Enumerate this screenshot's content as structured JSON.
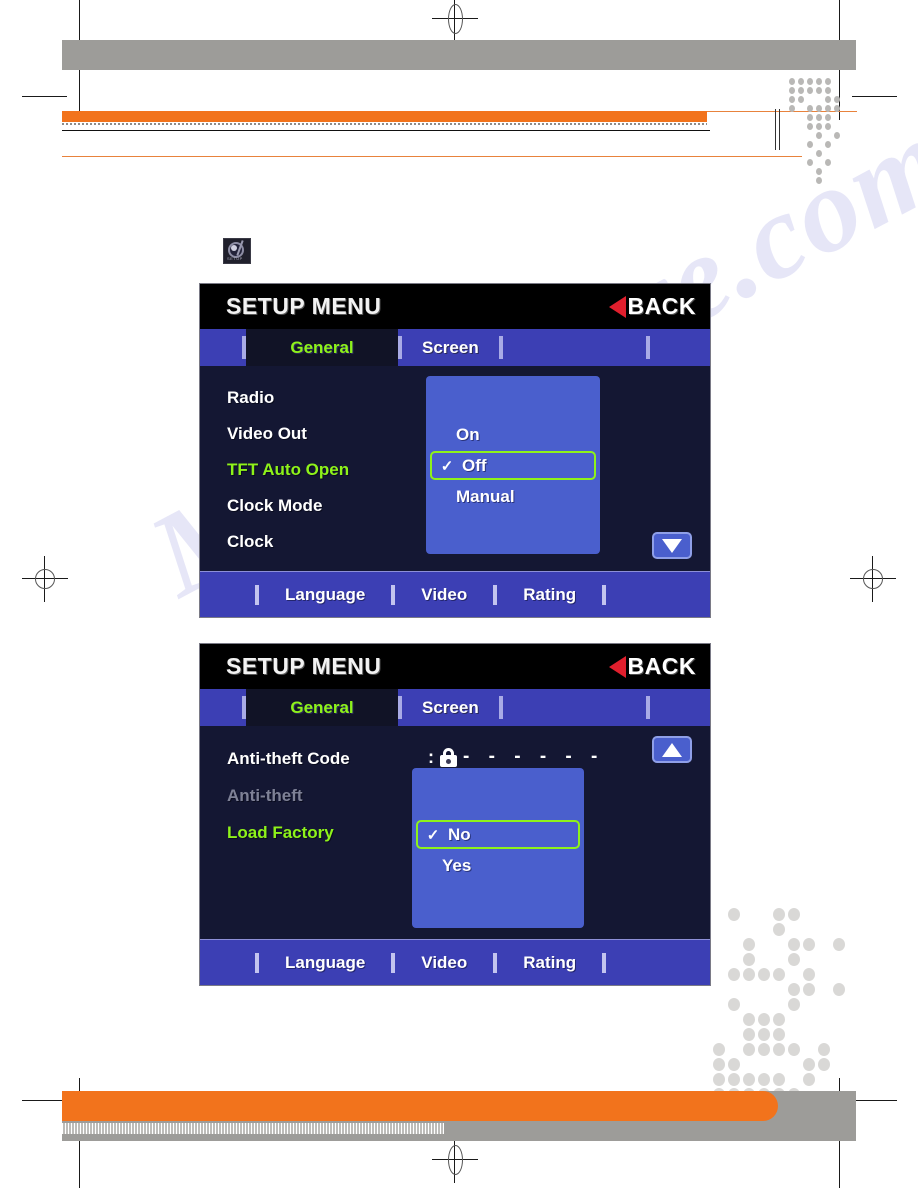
{
  "page": {
    "kind": "printed-manual-page",
    "accent_orange": "#f2731c",
    "accent_gray": "#9d9c99",
    "watermark_text": "Manualslive.com"
  },
  "setup_icon": {
    "name": "setup-icon",
    "caption": "SETUP"
  },
  "screens": [
    {
      "id": "tv-general-tft",
      "title": "SETUP MENU",
      "back": {
        "label": "BACK",
        "arrow_color": "#e01f2d"
      },
      "tabs": [
        {
          "label": "General",
          "active": true
        },
        {
          "label": "Screen",
          "active": false
        }
      ],
      "menu_items": [
        {
          "label": "Radio",
          "state": "normal"
        },
        {
          "label": "Video Out",
          "state": "normal"
        },
        {
          "label": "TFT Auto Open",
          "state": "selected"
        },
        {
          "label": "Clock Mode",
          "state": "normal"
        },
        {
          "label": "Clock",
          "state": "normal"
        }
      ],
      "option_box": {
        "options": [
          {
            "label": "On",
            "checked": false,
            "highlighted": false
          },
          {
            "label": "Off",
            "checked": true,
            "highlighted": true
          },
          {
            "label": "Manual",
            "checked": false,
            "highlighted": false
          }
        ],
        "check_glyph": "✓"
      },
      "nav_button": {
        "name": "scroll-down-button",
        "direction": "down"
      },
      "bottom_items": [
        "Language",
        "Video",
        "Rating"
      ]
    },
    {
      "id": "tv-general-antitheft",
      "title": "SETUP MENU",
      "back": {
        "label": "BACK",
        "arrow_color": "#e01f2d"
      },
      "tabs": [
        {
          "label": "General",
          "active": true
        },
        {
          "label": "Screen",
          "active": false
        }
      ],
      "menu_items": [
        {
          "label": "Anti-theft Code",
          "state": "normal"
        },
        {
          "label": "Anti-theft",
          "state": "disabled"
        },
        {
          "label": "Load Factory",
          "state": "selected"
        }
      ],
      "code_row": {
        "colon": ":",
        "lock_icon": "lock-icon",
        "dashes": "- - - - - -"
      },
      "option_box": {
        "options": [
          {
            "label": "No",
            "checked": true,
            "highlighted": true
          },
          {
            "label": "Yes",
            "checked": false,
            "highlighted": false
          }
        ],
        "check_glyph": "✓"
      },
      "nav_button": {
        "name": "scroll-up-button",
        "direction": "up"
      },
      "bottom_items": [
        "Language",
        "Video",
        "Rating"
      ]
    }
  ]
}
